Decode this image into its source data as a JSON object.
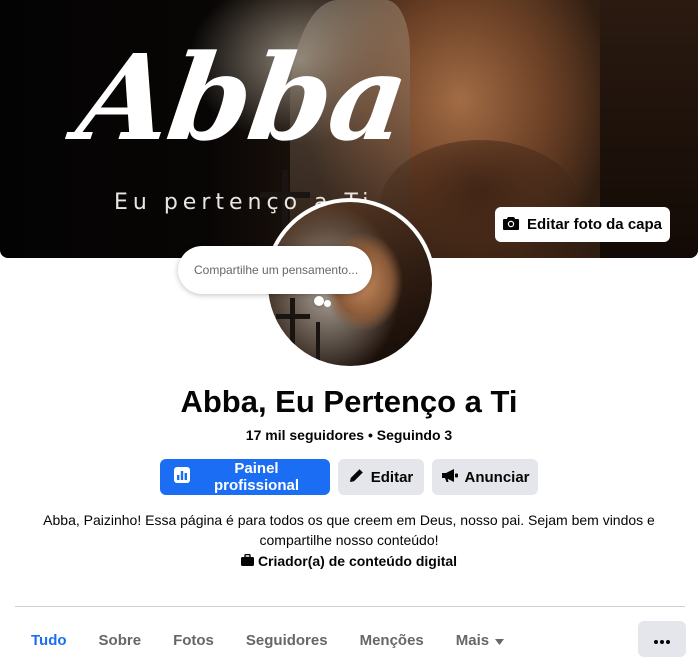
{
  "cover": {
    "title_script": "Abba",
    "subtitle": "Eu pertenço a Ti",
    "edit_button_label": "Editar foto da capa",
    "edit_button_icon": "camera-icon"
  },
  "thought_bubble": {
    "placeholder": "Compartilhe um pensamento..."
  },
  "profile": {
    "name": "Abba, Eu Pertenço a Ti",
    "stats": "17 mil seguidores • Seguindo 3",
    "bio": "Abba, Paizinho! Essa página é para todos os que creem em Deus, nosso pai. Sejam bem vindos e compartilhe nosso conteúdo!",
    "category": "Criador(a) de conteúdo digital",
    "category_icon": "briefcase-icon"
  },
  "actions": {
    "professional_panel": "Painel profissional",
    "edit": "Editar",
    "advertise": "Anunciar"
  },
  "tabs": [
    {
      "label": "Tudo",
      "active": true
    },
    {
      "label": "Sobre"
    },
    {
      "label": "Fotos"
    },
    {
      "label": "Seguidores"
    },
    {
      "label": "Menções"
    },
    {
      "label": "Mais"
    }
  ],
  "colors": {
    "accent": "#1b6ef3",
    "secondary_button": "#e4e6eb",
    "muted_text": "#65676b"
  }
}
